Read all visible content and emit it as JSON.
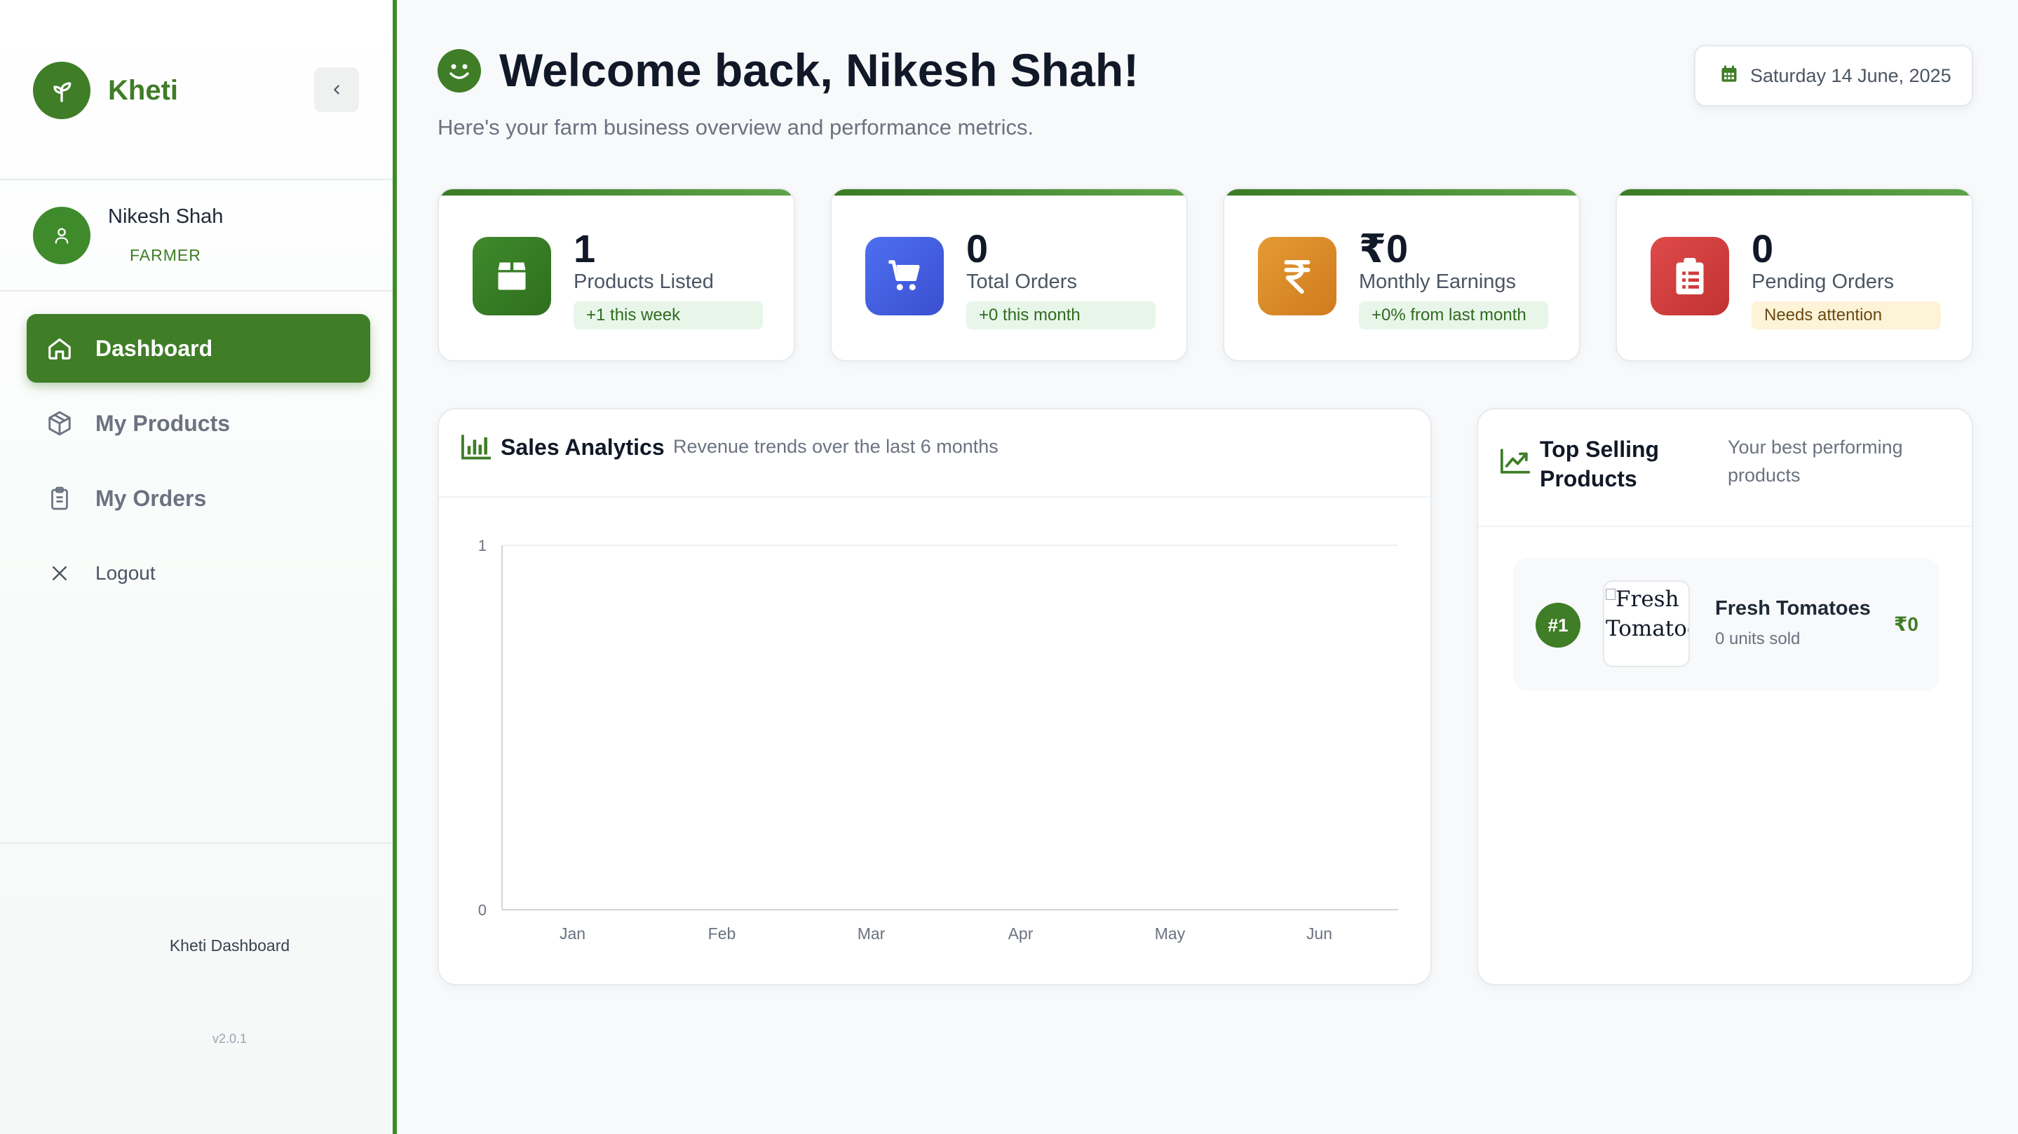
{
  "sidebar": {
    "brand": "Kheti",
    "user": {
      "name": "Nikesh Shah",
      "role": "FARMER"
    },
    "nav": [
      {
        "label": "Dashboard",
        "icon": "home-icon",
        "active": true
      },
      {
        "label": "My Products",
        "icon": "package-icon",
        "active": false
      },
      {
        "label": "My Orders",
        "icon": "clipboard-icon",
        "active": false
      },
      {
        "label": "Logout",
        "icon": "close-icon",
        "active": false
      }
    ],
    "footer": "Kheti Dashboard",
    "version": "v2.0.1"
  },
  "header": {
    "title": "Welcome back, Nikesh Shah!",
    "subtitle": "Here's your farm business overview and performance metrics.",
    "date": "Saturday 14 June, 2025"
  },
  "stats": [
    {
      "value": "1",
      "label": "Products Listed",
      "badge": "+1 this week",
      "icon": "box-icon",
      "color": "#3f8a2b"
    },
    {
      "value": "0",
      "label": "Total Orders",
      "badge": "+0 this month",
      "icon": "cart-icon",
      "color": "#4461e0"
    },
    {
      "value": "₹0",
      "label": "Monthly Earnings",
      "badge": "+0% from last month",
      "icon": "rupee-icon",
      "color": "#e08f2c"
    },
    {
      "value": "0",
      "label": "Pending Orders",
      "badge": "Needs attention",
      "icon": "clipboard-list-icon",
      "color": "#d63c3c"
    }
  ],
  "sales": {
    "title": "Sales Analytics",
    "subtitle": "Revenue trends over the last 6 months"
  },
  "chart_data": {
    "type": "line",
    "categories": [
      "Jan",
      "Feb",
      "Mar",
      "Apr",
      "May",
      "Jun"
    ],
    "series": [
      {
        "values": [
          0,
          0,
          0,
          0,
          0,
          0
        ]
      }
    ],
    "ylim": [
      0,
      1
    ],
    "yticks": [
      "0",
      "1"
    ],
    "title": "",
    "xlabel": "",
    "ylabel": "",
    "grid": true
  },
  "top_selling": {
    "title_line1": "Top Selling",
    "title_line2": "Products",
    "subtitle_line1": "Your best performing",
    "subtitle_line2": "products",
    "items": [
      {
        "rank": "#1",
        "alt": "Fresh Tomatoe",
        "alt_line1": "Fresh",
        "alt_line2": "Tomatoe",
        "name": "Fresh Tomatoes",
        "sold": "0 units sold",
        "price": "₹0"
      }
    ]
  }
}
